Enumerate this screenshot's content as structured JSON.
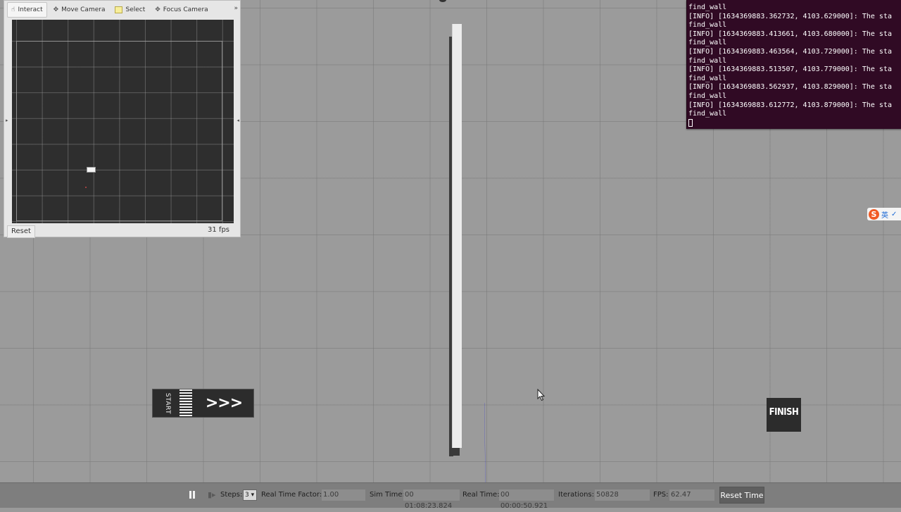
{
  "viewer": {
    "toolbar": {
      "interact": "Interact",
      "move_camera": "Move Camera",
      "select": "Select",
      "focus_camera": "Focus Camera",
      "more": "»"
    },
    "reset_label": "Reset",
    "fps": "31 fps"
  },
  "terminal": {
    "lines": [
      "find_wall",
      "[INFO] [1634369883.362732, 4103.629000]: The sta",
      "find_wall",
      "[INFO] [1634369883.413661, 4103.680000]: The sta",
      "find_wall",
      "[INFO] [1634369883.463564, 4103.729000]: The sta",
      "find_wall",
      "[INFO] [1634369883.513507, 4103.779000]: The sta",
      "find_wall",
      "[INFO] [1634369883.562937, 4103.829000]: The sta",
      "find_wall",
      "[INFO] [1634369883.612772, 4103.879000]: The sta",
      "find_wall"
    ]
  },
  "scene": {
    "start_word": "START",
    "start_arrows": ">>>",
    "finish_word": "FINISH"
  },
  "ime": {
    "logo": "S",
    "lang": "英",
    "mark": "✓"
  },
  "status_bar": {
    "steps_label": "Steps:",
    "steps_value": "3 ▾",
    "real_time_factor_label": "Real Time Factor:",
    "real_time_factor_value": "1.00",
    "sim_time_label": "Sim Time:",
    "sim_time_value": "00 01:08:23.824",
    "real_time_label": "Real Time:",
    "real_time_value": "00 00:00:50.921",
    "iterations_label": "Iterations:",
    "iterations_value": "50828",
    "fps_label": "FPS:",
    "fps_value": "62.47",
    "reset_time_label": "Reset Time"
  },
  "colors": {
    "scene_background": "#9b9b9b",
    "terminal_background": "#300a24",
    "status_bar": "#7e7e7e",
    "laser": "#2f2fd0"
  }
}
